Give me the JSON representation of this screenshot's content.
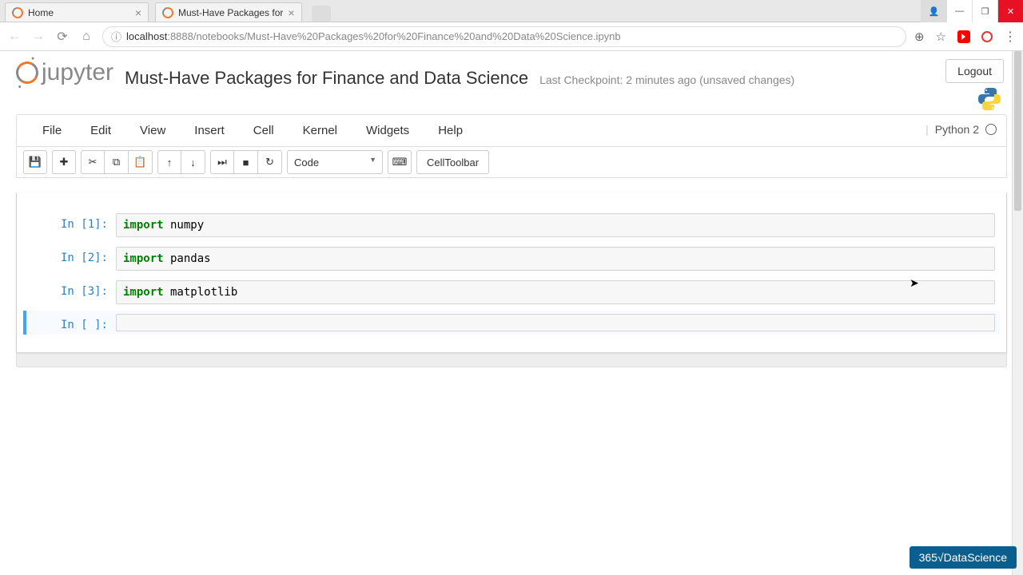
{
  "browser": {
    "tabs": [
      {
        "title": "Home"
      },
      {
        "title": "Must-Have Packages for"
      }
    ],
    "url_host": "localhost",
    "url_port_path": ":8888/notebooks/Must-Have%20Packages%20for%20Finance%20and%20Data%20Science.ipynb"
  },
  "header": {
    "logo_text": "jupyter",
    "title": "Must-Have Packages for Finance and Data Science",
    "checkpoint": "Last Checkpoint: 2 minutes ago (unsaved changes)",
    "logout": "Logout"
  },
  "menu": [
    "File",
    "Edit",
    "View",
    "Insert",
    "Cell",
    "Kernel",
    "Widgets",
    "Help"
  ],
  "kernel": "Python 2",
  "toolbar": {
    "cell_type": "Code",
    "cell_toolbar": "CellToolbar"
  },
  "cells": [
    {
      "prompt": "In [1]:",
      "code_kw": "import",
      "code_rest": " numpy"
    },
    {
      "prompt": "In [2]:",
      "code_kw": "import",
      "code_rest": " pandas"
    },
    {
      "prompt": "In [3]:",
      "code_kw": "import",
      "code_rest": " matplotlib"
    },
    {
      "prompt": "In [ ]:",
      "code_kw": "",
      "code_rest": ""
    }
  ],
  "watermark": "365√DataScience"
}
